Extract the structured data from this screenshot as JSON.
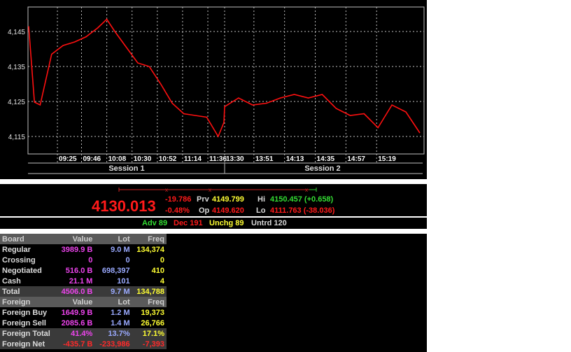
{
  "chart": {
    "y_ticks": [
      "4,145",
      "4,135",
      "4,125",
      "4,115"
    ],
    "x_ticks": [
      "09:25",
      "09:46",
      "10:08",
      "10:30",
      "10:52",
      "11:14",
      "11:36",
      "13:30",
      "13:51",
      "14:13",
      "14:35",
      "14:57",
      "15:19"
    ],
    "sessions": [
      "Session 1",
      "Session 2"
    ],
    "line_color": "#ff1010"
  },
  "chart_data": {
    "type": "line",
    "x": [
      "09:00",
      "09:05",
      "09:10",
      "09:20",
      "09:30",
      "09:40",
      "09:50",
      "10:00",
      "10:08",
      "10:15",
      "10:25",
      "10:35",
      "10:45",
      "10:55",
      "11:05",
      "11:15",
      "11:25",
      "11:35",
      "11:45",
      "11:50",
      "13:30",
      "13:40",
      "13:50",
      "14:00",
      "14:10",
      "14:20",
      "14:30",
      "14:40",
      "14:50",
      "15:00",
      "15:10",
      "15:20",
      "15:30",
      "15:40",
      "15:50"
    ],
    "series": [
      {
        "values": [
          4146.5,
          4124.8,
          4124.0,
          4138.5,
          4141.0,
          4142.0,
          4143.5,
          4146.0,
          4148.5,
          4145.0,
          4140.5,
          4136.0,
          4135.0,
          4130.0,
          4124.5,
          4121.5,
          4121.0,
          4120.5,
          4115.0,
          4119.0,
          4123.5,
          4126.0,
          4124.0,
          4124.5,
          4126.0,
          4127.0,
          4126.0,
          4127.0,
          4123.0,
          4121.0,
          4121.5,
          4117.5,
          4124.0,
          4122.0,
          4116.0
        ]
      }
    ],
    "ylim": [
      4110.0,
      4152.0
    ],
    "grid": true
  },
  "quote": {
    "last": "4130.013",
    "change": "-19.786",
    "change_pct": "-0.48%",
    "prv_label": "Prv",
    "prv_value": "4149.799",
    "op_label": "Op",
    "op_value": "4149.620",
    "hi_label": "Hi",
    "hi_value": "4150.457 (+0.658)",
    "lo_label": "Lo",
    "lo_value": "4111.763 (-38.036)"
  },
  "breadth": {
    "adv": "Adv 89",
    "dec": "Dec 191",
    "unchg": "Unchg 89",
    "untrd": "Untrd 120"
  },
  "board": {
    "headers": [
      "Board",
      "Value",
      "Lot",
      "Freq"
    ],
    "rows": [
      [
        "Regular",
        "3989.9 B",
        "9.0 M",
        "134,374"
      ],
      [
        "Crossing",
        "0",
        "0",
        "0"
      ],
      [
        "Negotiated",
        "516.0 B",
        "698,397",
        "410"
      ],
      [
        "Cash",
        "21.1 M",
        "101",
        "4"
      ]
    ],
    "total": [
      "Total",
      "4506.0 B",
      "9.7 M",
      "134,788"
    ]
  },
  "foreign": {
    "headers": [
      "Foreign",
      "Value",
      "Lot",
      "Freq"
    ],
    "rows": [
      [
        "Foreign Buy",
        "1649.9 B",
        "1.2 M",
        "19,373"
      ],
      [
        "Foreign Sell",
        "2085.6 B",
        "1.4 M",
        "26,766"
      ]
    ],
    "total": [
      "Foreign Total",
      "41.4%",
      "13.7%",
      "17.1%"
    ],
    "net": [
      "Foreign Net",
      "-435.7 B",
      "-233,986",
      "-7,393"
    ]
  }
}
